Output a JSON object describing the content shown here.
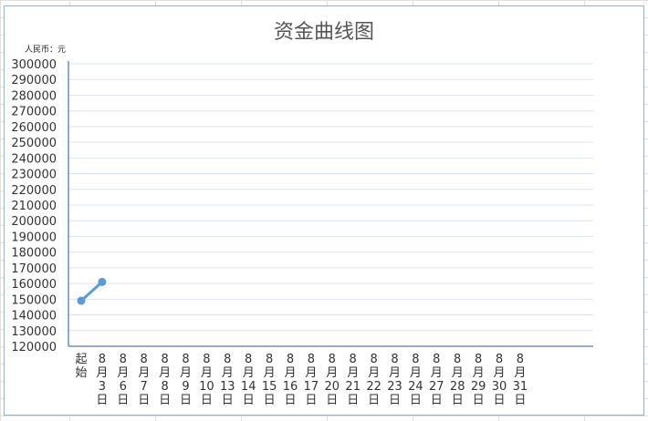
{
  "chart_data": {
    "type": "line",
    "title": "资金曲线图",
    "unit_label": "人民币：元",
    "xlabel": "",
    "ylabel": "",
    "categories": [
      "起始",
      "8月3日",
      "8月6日",
      "8月7日",
      "8月8日",
      "8月9日",
      "8月10日",
      "8月13日",
      "8月14日",
      "8月15日",
      "8月16日",
      "8月17日",
      "8月20日",
      "8月21日",
      "8月22日",
      "8月23日",
      "8月24日",
      "8月27日",
      "8月28日",
      "8月29日",
      "8月30日",
      "8月31日"
    ],
    "series": [
      {
        "values": [
          149000,
          161000,
          null,
          null,
          null,
          null,
          null,
          null,
          null,
          null,
          null,
          null,
          null,
          null,
          null,
          null,
          null,
          null,
          null,
          null,
          null,
          null
        ]
      }
    ],
    "ylim": [
      120000,
      300000
    ],
    "y_ticks": [
      120000,
      130000,
      140000,
      150000,
      160000,
      170000,
      180000,
      190000,
      200000,
      210000,
      220000,
      230000,
      240000,
      250000,
      260000,
      270000,
      280000,
      290000,
      300000
    ],
    "grid": true,
    "legend": "none",
    "colors": {
      "line": "#5b9bd5",
      "grid": "#d9e5f4",
      "axis": "#4a7ebb",
      "frame": "#8db3e2",
      "text": "#333333",
      "sheet_grid": "#e0e0e0"
    }
  }
}
